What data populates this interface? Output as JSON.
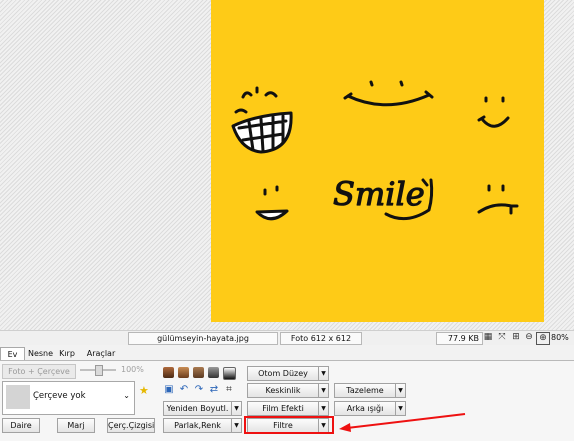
{
  "status_bar": {
    "filename": "gülümseyin-hayata.jpg",
    "photo_size": "Foto 612 x 612",
    "file_size": "77.9 KB",
    "zoom": "80%"
  },
  "tabs": [
    "Ev",
    "Nesne",
    "Kırp",
    "Araçlar"
  ],
  "ribbon": {
    "foto_cerceve": "Foto + Çerçeve",
    "zoom_percent": "100%",
    "frame_select": "Çerçeve yok",
    "daire": "Daire",
    "marj": "Marj",
    "cerc_cizgisi": "Çerç.Çizgisi",
    "yeniden_boyutl": "Yeniden Boyutl.",
    "parlak_renk": "Parlak,Renk",
    "otom_duzey": "Otom Düzey",
    "keskinlik": "Keskinlik",
    "film_efekti": "Film Efekti",
    "filtre": "Filtre",
    "tazeleme": "Tazeleme",
    "arka_isigi": "Arka ışığı"
  },
  "photo": {
    "smile_text": "Smile"
  },
  "colors": {
    "photo_bg": "#fecb17",
    "highlight": "#e11111"
  }
}
